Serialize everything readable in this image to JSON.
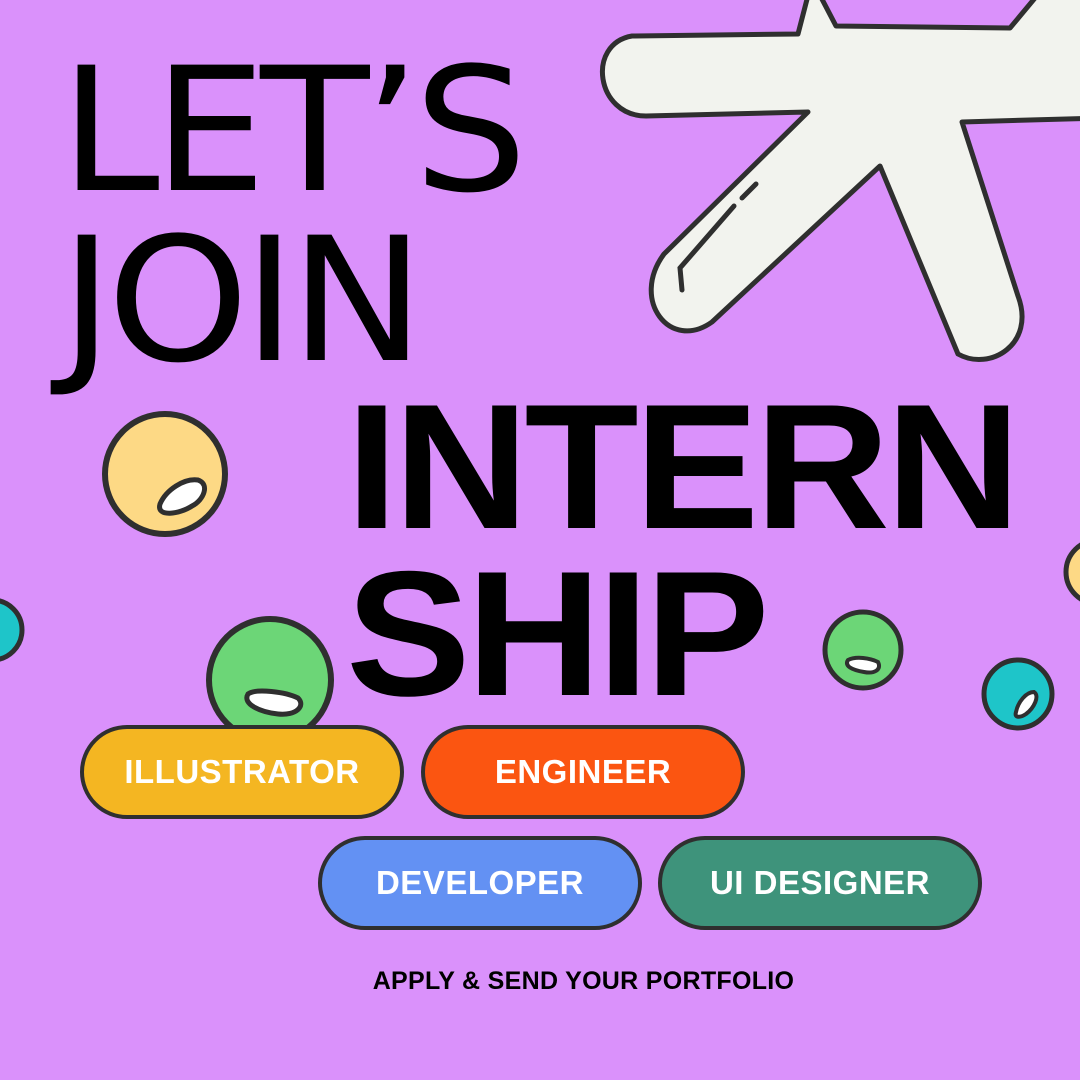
{
  "poster": {
    "headline": {
      "line1": "LET’S",
      "line2": "JOIN",
      "line3": "INTERN",
      "line4": "SHIP"
    },
    "roles": [
      {
        "label": "ILLUSTRATOR",
        "color": "#f4b622"
      },
      {
        "label": "ENGINEER",
        "color": "#fb5511"
      },
      {
        "label": "DEVELOPER",
        "color": "#6391f3"
      },
      {
        "label": "UI DESIGNER",
        "color": "#3e937b"
      }
    ],
    "cta": "APPLY & SEND YOUR PORTFOLIO",
    "colors": {
      "background": "#da91fb",
      "star": "#f2f3ee",
      "outline": "#2f2f2f",
      "yellow_blob": "#fdd985",
      "green_blob": "#6cd677",
      "teal_blob": "#1ec5c9"
    },
    "decorations": [
      "star-shape",
      "yellow-bubble",
      "green-bubble",
      "teal-bubble"
    ]
  }
}
